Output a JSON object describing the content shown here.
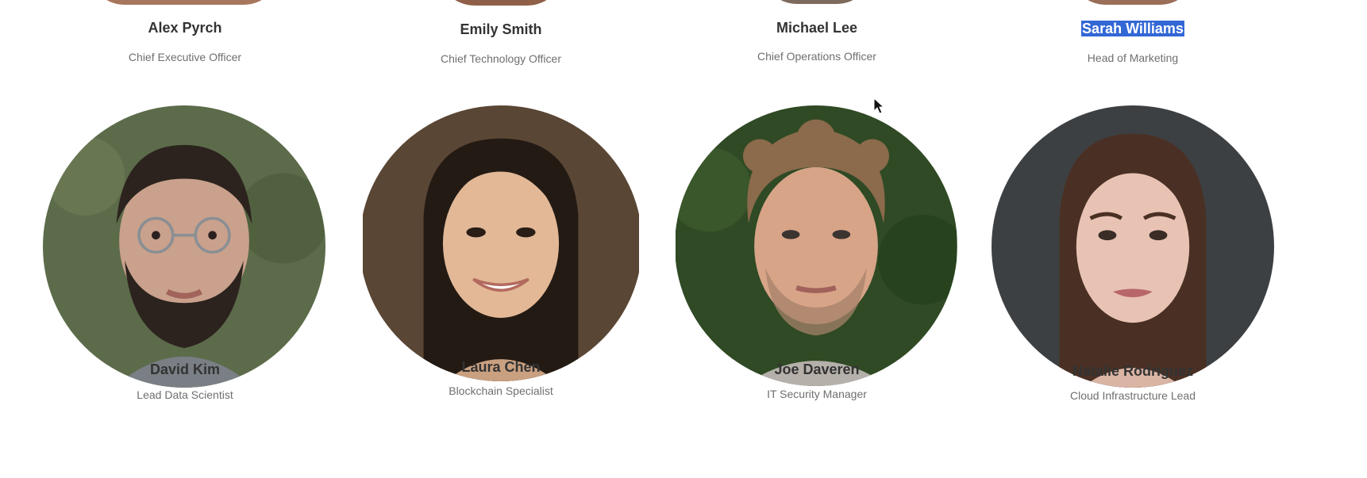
{
  "team": {
    "row1": [
      {
        "name": "Alex Pyrch",
        "role": "Chief Executive Officer",
        "photo_tone": "#a8765c"
      },
      {
        "name": "Emily Smith",
        "role": "Chief Technology Officer",
        "photo_tone": "#8f6047"
      },
      {
        "name": "Michael Lee",
        "role": "Chief Operations Officer",
        "photo_tone": "#7d6a5c"
      },
      {
        "name": "Sarah Williams",
        "role": "Head of Marketing",
        "photo_tone": "#9a6e58"
      }
    ],
    "row2": [
      {
        "name": "David Kim",
        "role": "Lead Data Scientist",
        "bg": "#5c6b4a",
        "skin": "#c9a18c",
        "hair": "#2c231e"
      },
      {
        "name": "Laura Chen",
        "role": "Blockchain Specialist",
        "bg": "#5a4634",
        "skin": "#e2b896",
        "hair": "#231a14"
      },
      {
        "name": "Joe Daveren",
        "role": "IT Security Manager",
        "bg": "#2f4a24",
        "skin": "#d7a488",
        "hair": "#8c6a4c"
      },
      {
        "name": "Natalie Rodriguez",
        "role": "Cloud Infrastructure Lead",
        "bg": "#3d4043",
        "skin": "#e8c3b3",
        "hair": "#4a3024"
      }
    ]
  },
  "colors": {
    "name_text": "#333333",
    "role_text": "#6f6f6f",
    "selection": "#3367d6"
  }
}
